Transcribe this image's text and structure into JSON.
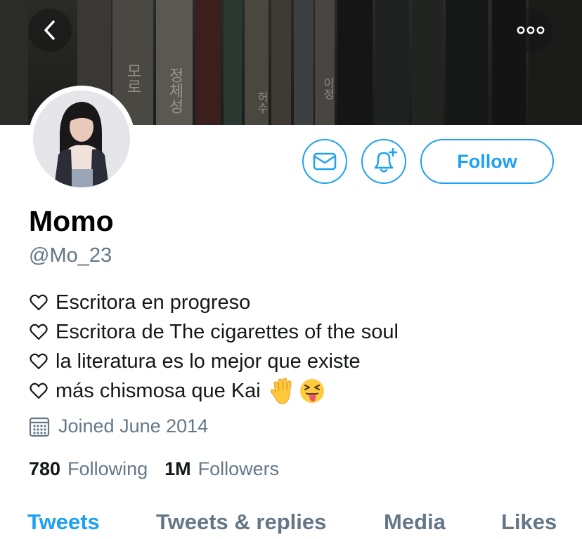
{
  "header": {
    "back_icon": "chevron-left-icon",
    "more_icon": "more-horizontal-icon",
    "banner_texts": [
      "모로",
      "정체성",
      "허수",
      "이정"
    ]
  },
  "actions": {
    "message_icon": "mail-icon",
    "notify_icon": "bell-plus-icon",
    "follow_label": "Follow"
  },
  "profile": {
    "name": "Momo",
    "handle": "@Mo_23",
    "bio": [
      "Escritora en progreso",
      "Escritora de The cigarettes of the soul",
      "la literatura es lo mejor que existe",
      "más chismosa que Kai"
    ],
    "joined": "Joined June 2014",
    "following_count": "780",
    "following_label": "Following",
    "followers_count": "1M",
    "followers_label": "Followers"
  },
  "tabs": [
    {
      "label": "Tweets",
      "active": true
    },
    {
      "label": "Tweets & replies",
      "active": false
    },
    {
      "label": "Media",
      "active": false
    },
    {
      "label": "Likes",
      "active": false
    }
  ],
  "colors": {
    "accent": "#1da1f2",
    "muted": "#657786",
    "text": "#14171a"
  }
}
